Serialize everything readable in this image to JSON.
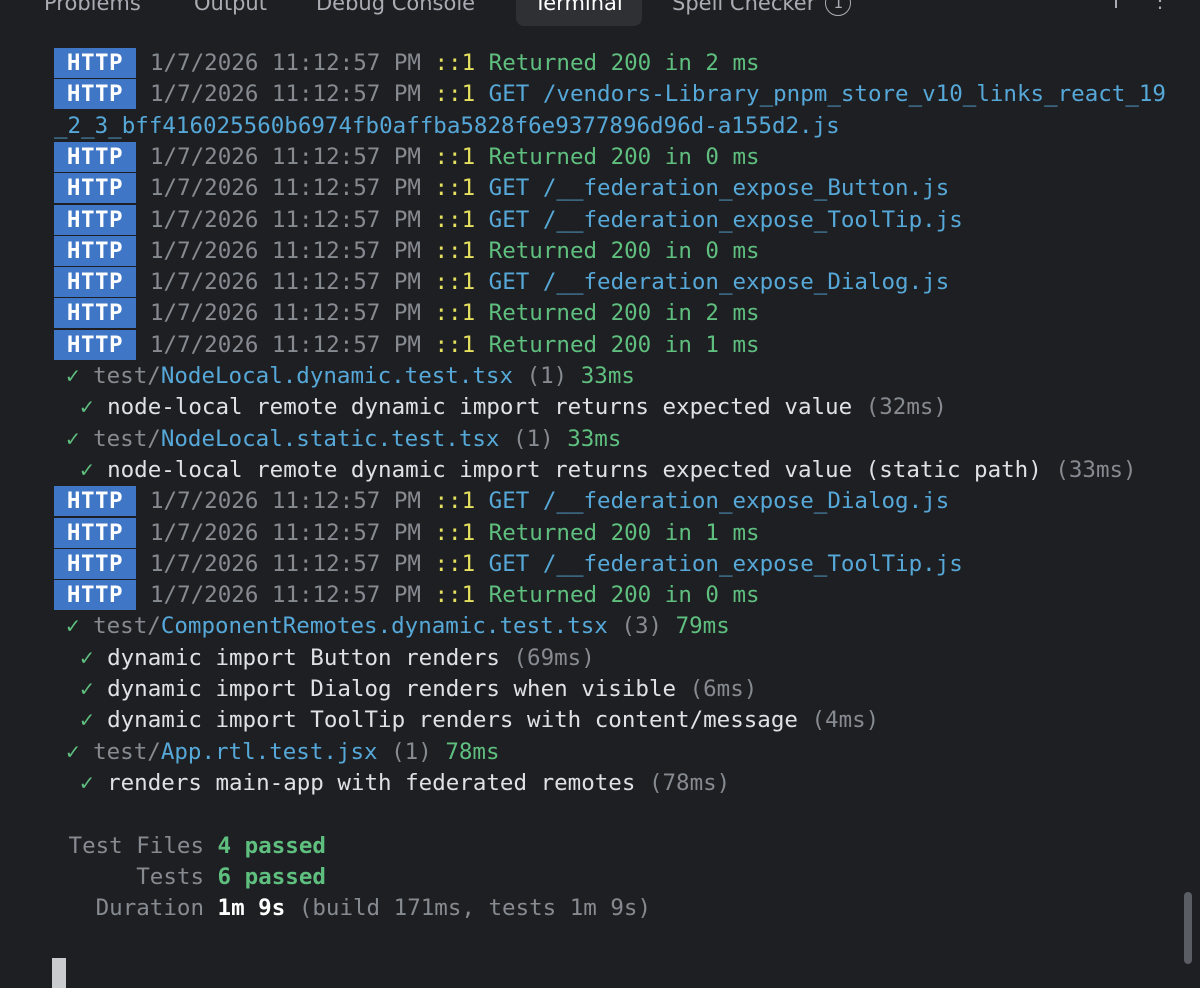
{
  "tabs": [
    {
      "label": "Problems"
    },
    {
      "label": "Output"
    },
    {
      "label": "Debug Console"
    },
    {
      "label": "Terminal"
    },
    {
      "label": "Spell Checker"
    }
  ],
  "spell_badge": "1",
  "http_tag": "HTTP",
  "log": [
    {
      "kind": "http",
      "ts": "1/7/2026 11:12:57 PM",
      "addr": "::1",
      "text": "Returned 200 in 2 ms",
      "color": "ok"
    },
    {
      "kind": "http",
      "ts": "1/7/2026 11:12:57 PM",
      "addr": "::1",
      "text": "GET /vendors-Library_pnpm_store_v10_links_react_19",
      "color": "get"
    },
    {
      "kind": "cont",
      "text": "_2_3_bff416025560b6974fb0affba5828f6e9377896d96d-a155d2.js"
    },
    {
      "kind": "http",
      "ts": "1/7/2026 11:12:57 PM",
      "addr": "::1",
      "text": "Returned 200 in 0 ms",
      "color": "ok"
    },
    {
      "kind": "http",
      "ts": "1/7/2026 11:12:57 PM",
      "addr": "::1",
      "text": "GET /__federation_expose_Button.js",
      "color": "get"
    },
    {
      "kind": "http",
      "ts": "1/7/2026 11:12:57 PM",
      "addr": "::1",
      "text": "GET /__federation_expose_ToolTip.js",
      "color": "get"
    },
    {
      "kind": "http",
      "ts": "1/7/2026 11:12:57 PM",
      "addr": "::1",
      "text": "Returned 200 in 0 ms",
      "color": "ok"
    },
    {
      "kind": "http",
      "ts": "1/7/2026 11:12:57 PM",
      "addr": "::1",
      "text": "GET /__federation_expose_Dialog.js",
      "color": "get"
    },
    {
      "kind": "http",
      "ts": "1/7/2026 11:12:57 PM",
      "addr": "::1",
      "text": "Returned 200 in 2 ms",
      "color": "ok"
    },
    {
      "kind": "http",
      "ts": "1/7/2026 11:12:57 PM",
      "addr": "::1",
      "text": "Returned 200 in 1 ms",
      "color": "ok"
    },
    {
      "kind": "file",
      "check": "✓",
      "dir": "test/",
      "file": "NodeLocal.dynamic.test.tsx",
      "count": "(1)",
      "time": "33ms"
    },
    {
      "kind": "test",
      "check": "✓",
      "name": "node-local remote dynamic import returns expected value",
      "time": "(32ms)"
    },
    {
      "kind": "file",
      "check": "✓",
      "dir": "test/",
      "file": "NodeLocal.static.test.tsx",
      "count": "(1)",
      "time": "33ms"
    },
    {
      "kind": "test",
      "check": "✓",
      "name": "node-local remote dynamic import returns expected value (static path)",
      "time": "(33ms)"
    },
    {
      "kind": "http",
      "ts": "1/7/2026 11:12:57 PM",
      "addr": "::1",
      "text": "GET /__federation_expose_Dialog.js",
      "color": "get"
    },
    {
      "kind": "http",
      "ts": "1/7/2026 11:12:57 PM",
      "addr": "::1",
      "text": "Returned 200 in 1 ms",
      "color": "ok"
    },
    {
      "kind": "http",
      "ts": "1/7/2026 11:12:57 PM",
      "addr": "::1",
      "text": "GET /__federation_expose_ToolTip.js",
      "color": "get"
    },
    {
      "kind": "http",
      "ts": "1/7/2026 11:12:57 PM",
      "addr": "::1",
      "text": "Returned 200 in 0 ms",
      "color": "ok"
    },
    {
      "kind": "file",
      "check": "✓",
      "dir": "test/",
      "file": "ComponentRemotes.dynamic.test.tsx",
      "count": "(3)",
      "time": "79ms"
    },
    {
      "kind": "test",
      "check": "✓",
      "name": "dynamic import Button renders",
      "time": "(69ms)"
    },
    {
      "kind": "test",
      "check": "✓",
      "name": "dynamic import Dialog renders when visible",
      "time": "(6ms)"
    },
    {
      "kind": "test",
      "check": "✓",
      "name": "dynamic import ToolTip renders with content/message",
      "time": "(4ms)"
    },
    {
      "kind": "file",
      "check": "✓",
      "dir": "test/",
      "file": "App.rtl.test.jsx",
      "count": "(1)",
      "time": "78ms"
    },
    {
      "kind": "test",
      "check": "✓",
      "name": "renders main-app with federated remotes",
      "time": "(78ms)"
    }
  ],
  "summary": {
    "files_label": "Test Files",
    "files_value": "4 passed",
    "tests_label": "Tests",
    "tests_value": "6 passed",
    "duration_label": "Duration",
    "duration_value": "1m 9s",
    "duration_detail": "(build 171ms, tests 1m 9s)"
  },
  "colors": {
    "background": "#1e1f22",
    "http_badge": "#3f76c6",
    "success_green": "#5fbf7f",
    "path_blue": "#56a8d8",
    "address_yellow": "#e5e05f"
  }
}
